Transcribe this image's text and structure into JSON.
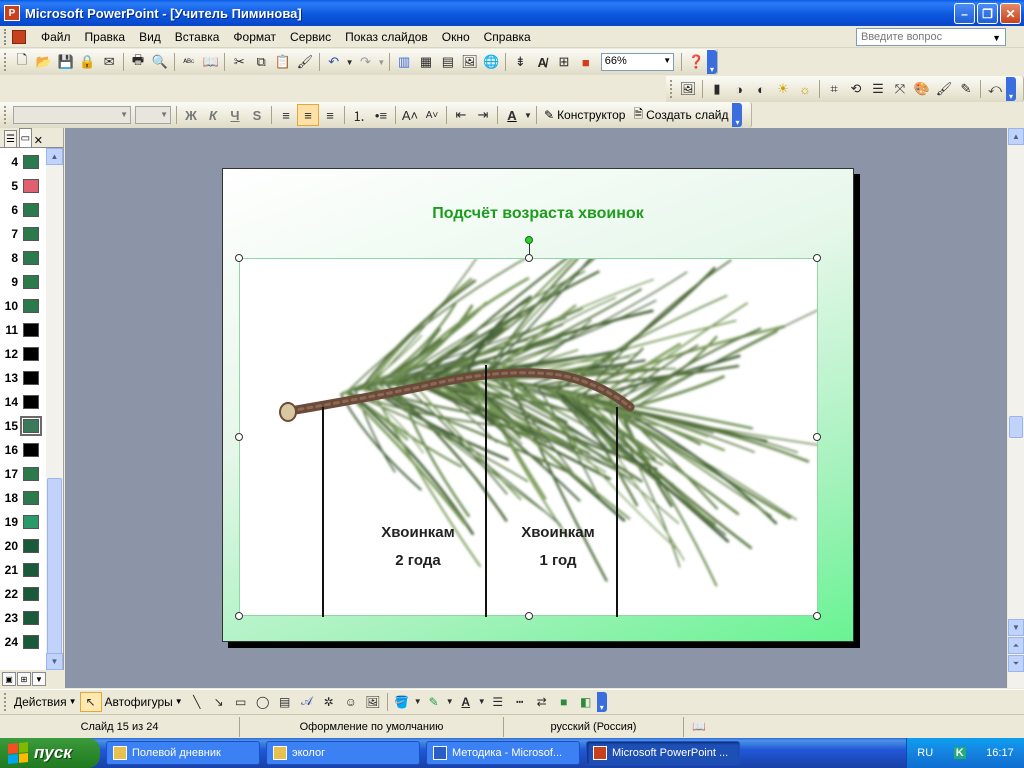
{
  "window": {
    "title": "Microsoft PowerPoint - [Учитель Пиминова]",
    "app_icon": "P"
  },
  "menu": {
    "items": [
      "Файл",
      "Правка",
      "Вид",
      "Вставка",
      "Формат",
      "Сервис",
      "Показ слайдов",
      "Окно",
      "Справка"
    ],
    "ask_placeholder": "Введите вопрос"
  },
  "standard_toolbar": {
    "zoom": "66%"
  },
  "format_toolbar": {
    "designer_label": "Конструктор",
    "new_slide_label": "Создать слайд",
    "bold": "Ж",
    "italic": "К",
    "underline": "Ч",
    "shadow": "S"
  },
  "slides_panel": {
    "slides": [
      {
        "num": "4",
        "thumb": "#2b7a4b"
      },
      {
        "num": "5",
        "thumb": "#e06070"
      },
      {
        "num": "6",
        "thumb": "#2b7a4b"
      },
      {
        "num": "7",
        "thumb": "#2b7a4b"
      },
      {
        "num": "8",
        "thumb": "#2b7a4b"
      },
      {
        "num": "9",
        "thumb": "#2b7a4b"
      },
      {
        "num": "10",
        "thumb": "#2b7a4b"
      },
      {
        "num": "11",
        "thumb": "#000000"
      },
      {
        "num": "12",
        "thumb": "#000000"
      },
      {
        "num": "13",
        "thumb": "#000000"
      },
      {
        "num": "14",
        "thumb": "#000000"
      },
      {
        "num": "15",
        "thumb": "#3a7a5a"
      },
      {
        "num": "16",
        "thumb": "#000000"
      },
      {
        "num": "17",
        "thumb": "#2b7a4b"
      },
      {
        "num": "18",
        "thumb": "#2b7a4b"
      },
      {
        "num": "19",
        "thumb": "#2b9a6b"
      },
      {
        "num": "20",
        "thumb": "#1a5a3a"
      },
      {
        "num": "21",
        "thumb": "#1a5a3a"
      },
      {
        "num": "22",
        "thumb": "#1a5a3a"
      },
      {
        "num": "23",
        "thumb": "#1a5a3a"
      },
      {
        "num": "24",
        "thumb": "#1a5a3a"
      }
    ],
    "selected": "15"
  },
  "slide": {
    "title": "Подсчёт возраста хвоинок",
    "title_color": "#1d9c1d",
    "caption_left_line1": "Хвоинкам",
    "caption_left_line2": "2 года",
    "caption_right_line1": "Хвоинкам",
    "caption_right_line2": "1 год"
  },
  "drawing_toolbar": {
    "actions_label": "Действия",
    "autoshapes_label": "Автофигуры"
  },
  "status": {
    "slide_counter": "Слайд 15 из 24",
    "design": "Оформление по умолчанию",
    "language": "русский (Россия)"
  },
  "taskbar": {
    "start_label": "пуск",
    "tasks": [
      {
        "label": "Полевой дневник",
        "icon": "folder-icon"
      },
      {
        "label": "эколог",
        "icon": "folder-icon"
      },
      {
        "label": "Методика - Microsof...",
        "icon": "word-icon"
      },
      {
        "label": "Microsoft PowerPoint ...",
        "icon": "powerpoint-icon"
      }
    ],
    "lang": "RU",
    "clock": "16:17"
  }
}
